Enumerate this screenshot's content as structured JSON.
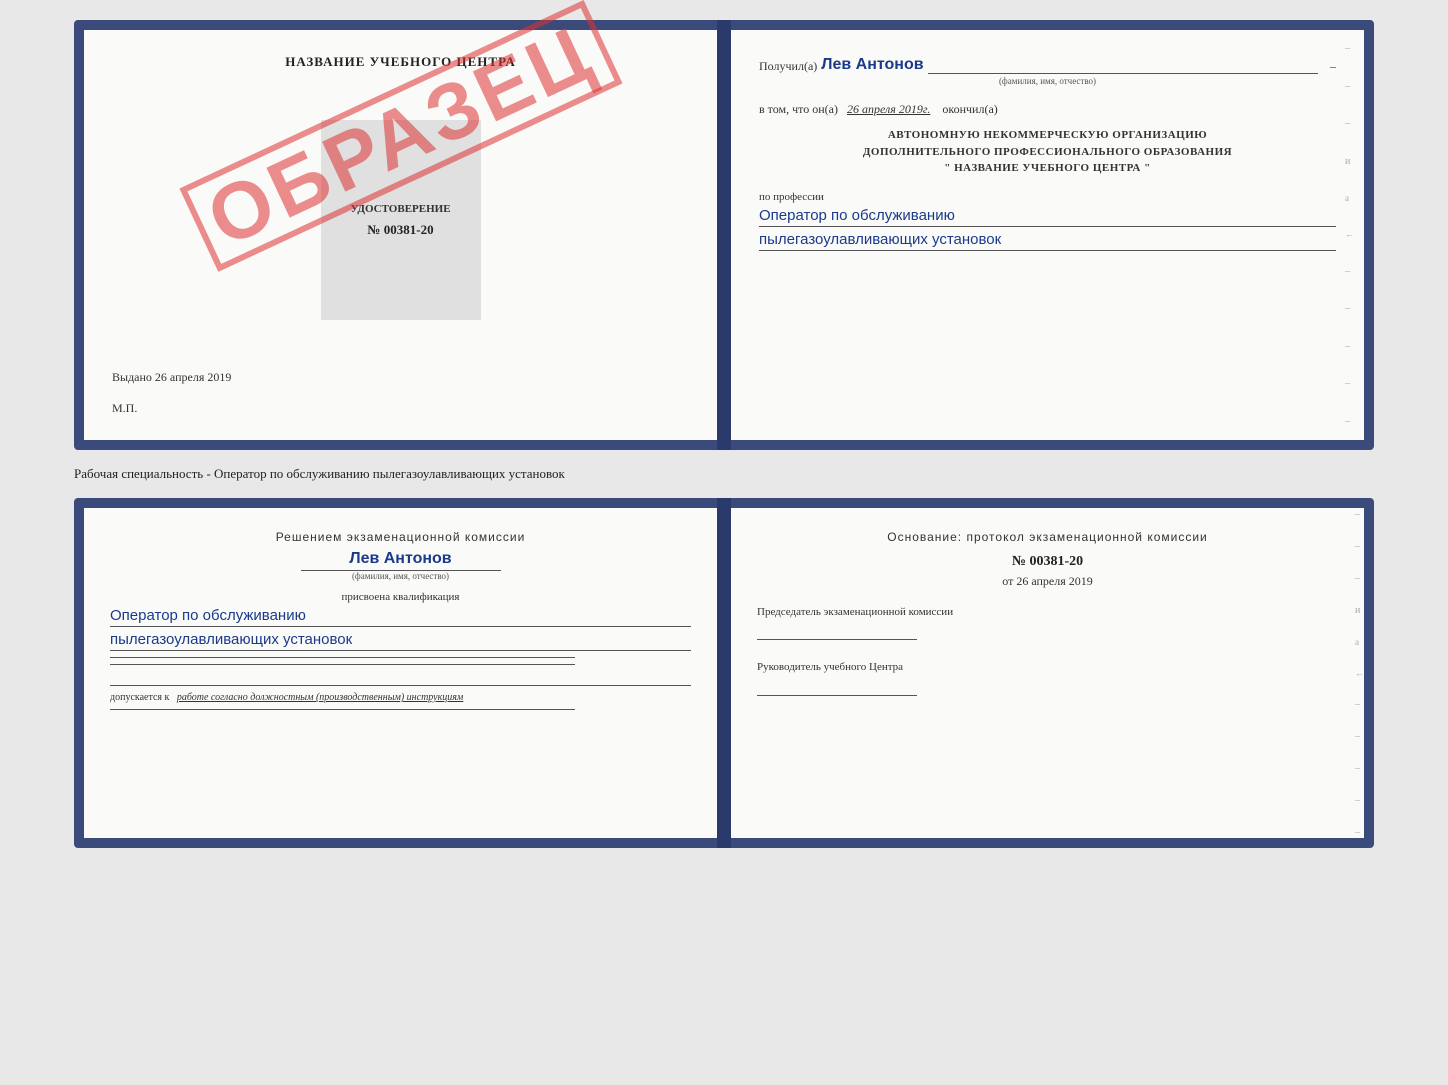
{
  "top_book": {
    "left_page": {
      "header": "НАЗВАНИЕ УЧЕБНОГО ЦЕНТРА",
      "stamp_text": "ОБРАЗЕЦ",
      "udostoverenie": {
        "title": "УДОСТОВЕРЕНИЕ",
        "number": "№ 00381-20"
      },
      "vydano_label": "Выдано",
      "vydano_date": "26 апреля 2019",
      "mp_label": "М.П."
    },
    "right_page": {
      "poluchil_label": "Получил(а)",
      "recipient_name": "Лев Антонов",
      "fio_hint": "(фамилия, имя, отчество)",
      "v_tom_label": "в том, что он(а)",
      "date_value": "26 апреля 2019г.",
      "okonchil_label": "окончил(а)",
      "org_line1": "АВТОНОМНУЮ НЕКОММЕРЧЕСКУЮ ОРГАНИЗАЦИЮ",
      "org_line2": "ДОПОЛНИТЕЛЬНОГО ПРОФЕССИОНАЛЬНОГО ОБРАЗОВАНИЯ",
      "org_line3": "\" НАЗВАНИЕ УЧЕБНОГО ЦЕНТРА \"",
      "profession_label": "по профессии",
      "profession_line1": "Оператор по обслуживанию",
      "profession_line2": "пылегазоулавливающих установок"
    }
  },
  "middle_label": "Рабочая специальность - Оператор по обслуживанию пылегазоулавливающих установок",
  "bottom_book": {
    "left_page": {
      "decision_header": "Решением экзаменационной комиссии",
      "person_name": "Лев Антонов",
      "fio_hint": "(фамилия, имя, отчество)",
      "assigned_label": "присвоена квалификация",
      "qualification_line1": "Оператор по обслуживанию",
      "qualification_line2": "пылегазоулавливающих установок",
      "dopuskaetsya_prefix": "допускается к",
      "dopuskaetsya_text": "работе согласно должностным (производственным) инструкциям"
    },
    "right_page": {
      "osnование_label": "Основание: протокол экзаменационной комиссии",
      "protocol_number": "№ 00381-20",
      "protocol_date_prefix": "от",
      "protocol_date": "26 апреля 2019",
      "predsedatel_label": "Председатель экзаменационной комиссии",
      "rukovoditel_label": "Руководитель учебного Центра"
    }
  },
  "dashes": [
    "-",
    "-",
    "-",
    "-",
    "и",
    "а",
    "←",
    "-",
    "-",
    "-",
    "-",
    "-",
    "-"
  ]
}
